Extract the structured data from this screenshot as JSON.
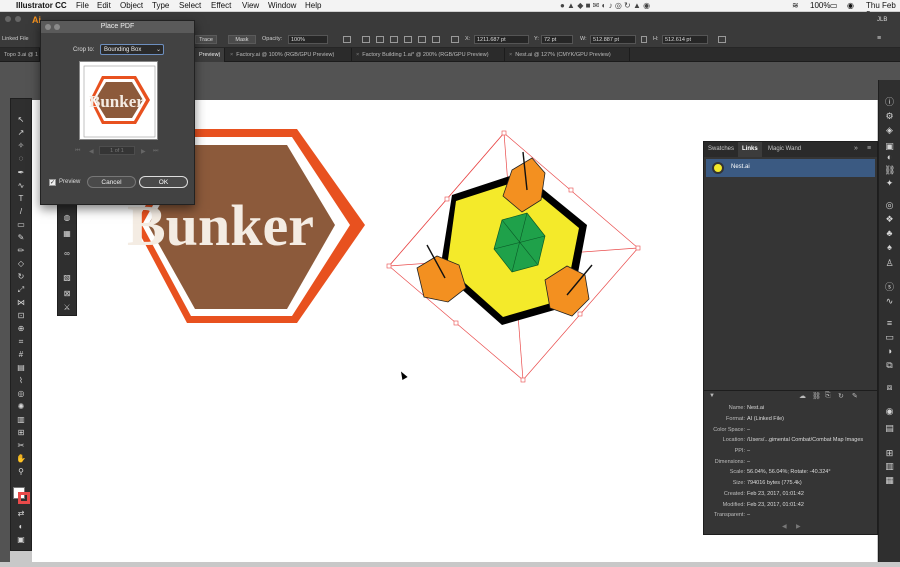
{
  "menubar": {
    "app_name": "Illustrator CC",
    "items": [
      "File",
      "Edit",
      "Object",
      "Type",
      "Select",
      "Effect",
      "View",
      "Window",
      "Help"
    ],
    "battery": "100%",
    "clock": "Thu Feb 2"
  },
  "app_badge": "Ai",
  "controlbar": {
    "linked_file": "Linked File",
    "trace_button": "Trace",
    "mask_button": "Mask",
    "opacity_label": "Opacity:",
    "opacity_value": "100%",
    "x_label": "X:",
    "x_value": "1211.687 pt",
    "y_label": "Y:",
    "y_value": "72 pt",
    "w_label": "W:",
    "w_value": "512.887 pt",
    "h_label": "H:",
    "h_value": "512.614 pt",
    "user": "JLB"
  },
  "tabs": [
    {
      "label": "Topo 3.ai @ 1"
    },
    {
      "label": "Preview)"
    },
    {
      "label": "Factory.ai @ 100% (RGB/GPU Preview)"
    },
    {
      "label": "Factory Building 1.ai* @ 200% (RGB/GPU Preview)"
    },
    {
      "label": "Nest.ai @ 127% (CMYK/GPU Preview)"
    }
  ],
  "dialog": {
    "title": "Place PDF",
    "crop_label": "Crop to:",
    "crop_value": "Bounding Box",
    "page_value": "1 of 1",
    "preview_label": "Preview",
    "cancel_button": "Cancel",
    "ok_button": "OK",
    "thumb_text": "Bunker"
  },
  "artwork": {
    "bunker_text": "Bunker",
    "colors": {
      "bunker_fill": "#8c5a3b",
      "bunker_stroke": "#e8511f",
      "nest_yellow": "#f4ea2a",
      "nest_green": "#1fa14a",
      "nest_orange": "#f39020",
      "selection": "#e94a4a"
    }
  },
  "panel": {
    "tabs": [
      "Swatches",
      "Links",
      "Magic Wand"
    ],
    "active_tab": "Links",
    "link_name": "Nest.ai",
    "info": [
      {
        "label": "Name:",
        "value": "Nest.ai"
      },
      {
        "label": "Format:",
        "value": "AI (Linked File)"
      },
      {
        "label": "Color Space:",
        "value": "–"
      },
      {
        "label": "Location:",
        "value": "/Users/...gimental Combat/Combat Map Images"
      },
      {
        "label": "PPI:",
        "value": "–"
      },
      {
        "label": "Dimensions:",
        "value": "–"
      },
      {
        "label": "Scale:",
        "value": "56.04%, 56.04%; Rotate: -40.324°"
      },
      {
        "label": "Size:",
        "value": "794016 bytes (775.4k)"
      },
      {
        "label": "Created:",
        "value": "Feb 23, 2017, 01:01:42"
      },
      {
        "label": "Modified:",
        "value": "Feb 23, 2017, 01:01:42"
      },
      {
        "label": "Transparent:",
        "value": "–"
      }
    ]
  }
}
